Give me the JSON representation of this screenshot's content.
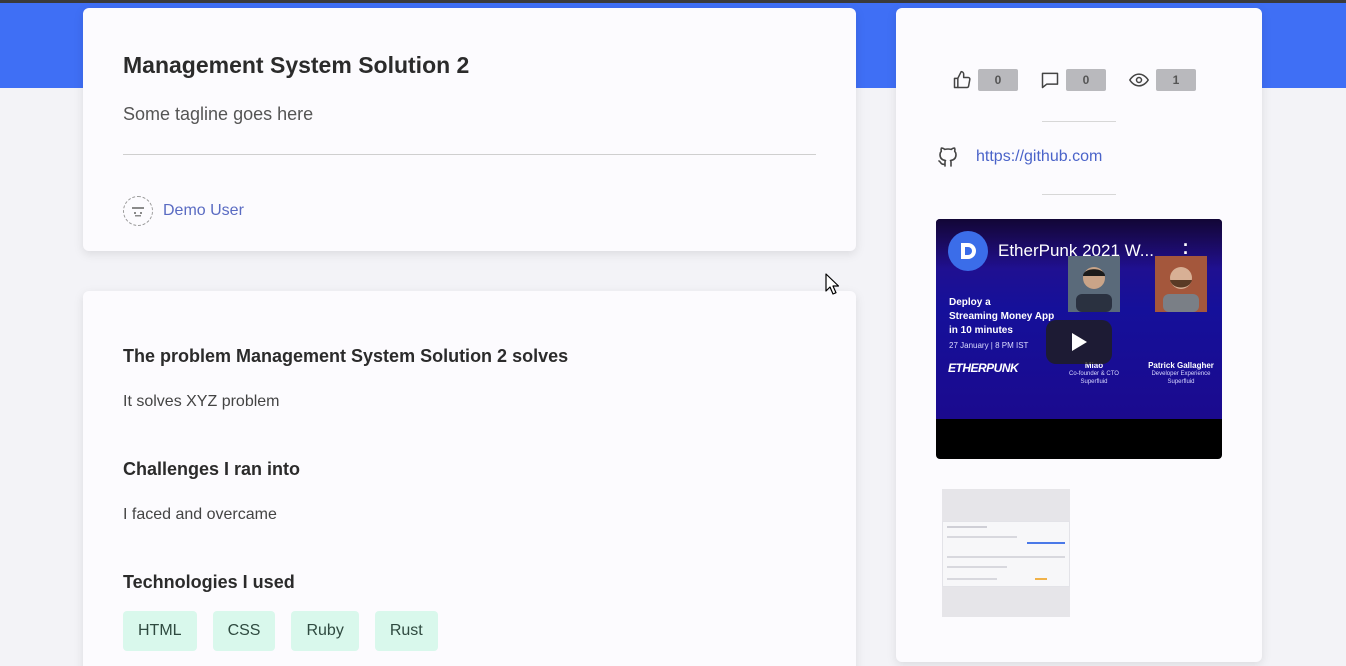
{
  "project": {
    "title": "Management System Solution 2",
    "tagline": "Some tagline goes here",
    "author": "Demo User"
  },
  "sections": {
    "problem_title": "The problem Management System Solution 2 solves",
    "problem_text": "It solves XYZ problem",
    "challenges_title": "Challenges I ran into",
    "challenges_text": "I faced and overcame",
    "tech_title": "Technologies I used",
    "technologies": [
      "HTML",
      "CSS",
      "Ruby",
      "Rust"
    ]
  },
  "stats": {
    "likes": "0",
    "comments": "0",
    "views": "1"
  },
  "links": {
    "github": "https://github.com"
  },
  "video": {
    "title": "EtherPunk 2021 W...",
    "slide_lines": [
      "Deploy a",
      "Streaming Money App",
      "in 10 minutes"
    ],
    "date": "27 January | 8 PM IST",
    "event_logo": "ETHERPUNK",
    "speaker1_name": "Miao",
    "speaker1_role_1": "Co-founder & CTO",
    "speaker1_role_2": "Superfluid",
    "speaker2_name": "Patrick Gallagher",
    "speaker2_role_1": "Developer Experience",
    "speaker2_role_2": "Superfluid"
  },
  "colors": {
    "banner": "#3f6ff5",
    "link": "#5a6bc2",
    "tag_bg": "#d9f8ec",
    "count_bg": "#b9b9bd"
  },
  "icons": [
    "thumbs-up-icon",
    "comment-icon",
    "eye-icon",
    "github-icon",
    "play-icon",
    "kebab-menu-icon"
  ]
}
